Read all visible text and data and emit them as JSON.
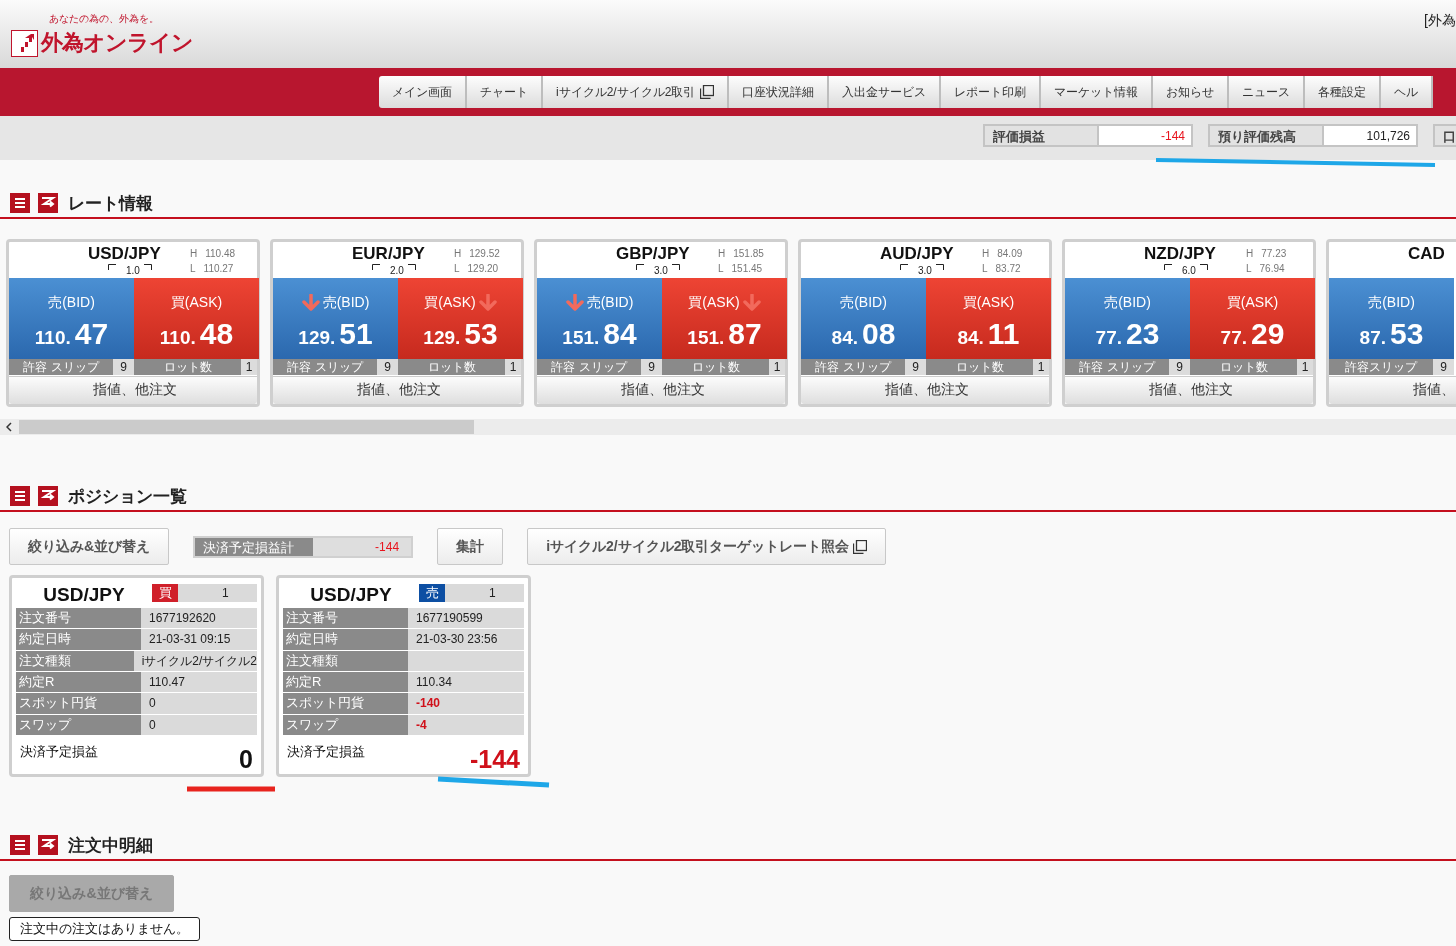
{
  "header": {
    "tagline": "あなたの為の、外為を。",
    "logo": "外為オンライン",
    "corner_text": "[外為"
  },
  "nav": [
    {
      "label": "メイン画面",
      "external": false
    },
    {
      "label": "チャート",
      "external": false
    },
    {
      "label": "iサイクル2/サイクル2取引",
      "external": true
    },
    {
      "label": "口座状況詳細",
      "external": false
    },
    {
      "label": "入出金サービス",
      "external": false
    },
    {
      "label": "レポート印刷",
      "external": false
    },
    {
      "label": "マーケット情報",
      "external": false
    },
    {
      "label": "お知らせ",
      "external": false
    },
    {
      "label": "ニュース",
      "external": false
    },
    {
      "label": "各種設定",
      "external": false
    },
    {
      "label": "ヘル",
      "external": false
    }
  ],
  "account": [
    {
      "label": "評価損益",
      "value": "-144",
      "negative": true
    },
    {
      "label": "預り評価残高",
      "value": "101,726",
      "negative": false
    },
    {
      "label": "口"
    }
  ],
  "rates": {
    "title": "レート情報",
    "cards": [
      {
        "pair": "USD/JPY",
        "spread": "1.0",
        "high_label": "H",
        "high": "110.48",
        "low_label": "L",
        "low": "110.27",
        "bid": {
          "label": "売(BID)",
          "big": "110.",
          "pips": "47",
          "falling": false
        },
        "ask": {
          "label": "買(ASK)",
          "big": "110.",
          "pips": "48",
          "falling": false
        },
        "slip_label": "許容 スリップ",
        "slip": "9",
        "lot_label": "ロット数",
        "lot": "1",
        "order_button": "指値、他注文"
      },
      {
        "pair": "EUR/JPY",
        "spread": "2.0",
        "high_label": "H",
        "high": "129.52",
        "low_label": "L",
        "low": "129.20",
        "bid": {
          "label": "売(BID)",
          "big": "129.",
          "pips": "51",
          "falling": true
        },
        "ask": {
          "label": "買(ASK)",
          "big": "129.",
          "pips": "53",
          "falling": true
        },
        "slip_label": "許容 スリップ",
        "slip": "9",
        "lot_label": "ロット数",
        "lot": "1",
        "order_button": "指値、他注文"
      },
      {
        "pair": "GBP/JPY",
        "spread": "3.0",
        "high_label": "H",
        "high": "151.85",
        "low_label": "L",
        "low": "151.45",
        "bid": {
          "label": "売(BID)",
          "big": "151.",
          "pips": "84",
          "falling": true
        },
        "ask": {
          "label": "買(ASK)",
          "big": "151.",
          "pips": "87",
          "falling": true
        },
        "slip_label": "許容 スリップ",
        "slip": "9",
        "lot_label": "ロット数",
        "lot": "1",
        "order_button": "指値、他注文"
      },
      {
        "pair": "AUD/JPY",
        "spread": "3.0",
        "high_label": "H",
        "high": "84.09",
        "low_label": "L",
        "low": "83.72",
        "bid": {
          "label": "売(BID)",
          "big": "84.",
          "pips": "08",
          "falling": false
        },
        "ask": {
          "label": "買(ASK)",
          "big": "84.",
          "pips": "11",
          "falling": false
        },
        "slip_label": "許容 スリップ",
        "slip": "9",
        "lot_label": "ロット数",
        "lot": "1",
        "order_button": "指値、他注文"
      },
      {
        "pair": "NZD/JPY",
        "spread": "6.0",
        "high_label": "H",
        "high": "77.23",
        "low_label": "L",
        "low": "76.94",
        "bid": {
          "label": "売(BID)",
          "big": "77.",
          "pips": "23",
          "falling": false
        },
        "ask": {
          "label": "買(ASK)",
          "big": "77.",
          "pips": "29",
          "falling": false
        },
        "slip_label": "許容 スリップ",
        "slip": "9",
        "lot_label": "ロット数",
        "lot": "1",
        "order_button": "指値、他注文"
      },
      {
        "pair": "CAD",
        "bid": {
          "label": "売(BID)",
          "big": "87.",
          "pips": "53",
          "falling": false
        },
        "slip_label": "許容スリップ",
        "slip": "9",
        "order_button": "指値、"
      }
    ]
  },
  "positions": {
    "title": "ポジション一覧",
    "filter_button": "絞り込み&並び替え",
    "total_label": "決済予定損益計",
    "total_value": "-144",
    "total_negative": true,
    "summary_button": "集計",
    "target_button": "iサイクル2/サイクル2取引ターゲットレート照会",
    "cards": [
      {
        "pair": "USD/JPY",
        "side": {
          "label": "買",
          "kind": "buy"
        },
        "quantity": "1",
        "rows": [
          {
            "label": "注文番号",
            "value": "1677192620",
            "negative": false
          },
          {
            "label": "約定日時",
            "value": "21-03-31 09:15",
            "negative": false
          },
          {
            "label": "注文種類",
            "value": "iサイクル2/サイクル2",
            "negative": false
          },
          {
            "label": "約定R",
            "value": "110.47",
            "negative": false
          },
          {
            "label": "スポット円貨",
            "value": "0",
            "negative": false
          },
          {
            "label": "スワップ",
            "value": "0",
            "negative": false
          }
        ],
        "pnl_label": "決済予定損益",
        "pnl": "0",
        "pnl_negative": false
      },
      {
        "pair": "USD/JPY",
        "side": {
          "label": "売",
          "kind": "sell"
        },
        "quantity": "1",
        "rows": [
          {
            "label": "注文番号",
            "value": "1677190599",
            "negative": false
          },
          {
            "label": "約定日時",
            "value": "21-03-30 23:56",
            "negative": false
          },
          {
            "label": "注文種類"
          },
          {
            "label": "約定R",
            "value": "110.34",
            "negative": false
          },
          {
            "label": "スポット円貨",
            "value": "-140",
            "negative": true
          },
          {
            "label": "スワップ",
            "value": "-4",
            "negative": true
          }
        ],
        "pnl_label": "決済予定損益",
        "pnl": "-144",
        "pnl_negative": true
      }
    ]
  },
  "orders": {
    "title": "注文中明細",
    "filter_button": "絞り込み&並び替え",
    "filter_disabled": true,
    "empty_message": "注文中の注文はありません。"
  }
}
